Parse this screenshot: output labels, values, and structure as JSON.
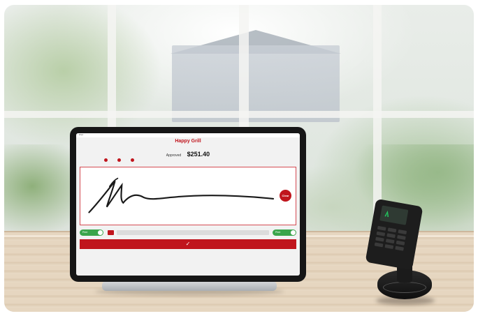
{
  "tablet": {
    "app_title": "Happy Grill",
    "amount_label": "Approved",
    "amount_value": "$251.40",
    "status_left": "iPad",
    "clear_label": "Clear",
    "toggle_left_label": "Print",
    "toggle_right_label": "Print",
    "memo_placeholder": "",
    "submit_symbol": "✓",
    "footer": ""
  },
  "colors": {
    "accent": "#c0151d",
    "toggle_on": "#3aa54b",
    "device_body": "#161616"
  },
  "icons": {
    "submit": "checkmark-icon",
    "options": "dot-icon"
  }
}
